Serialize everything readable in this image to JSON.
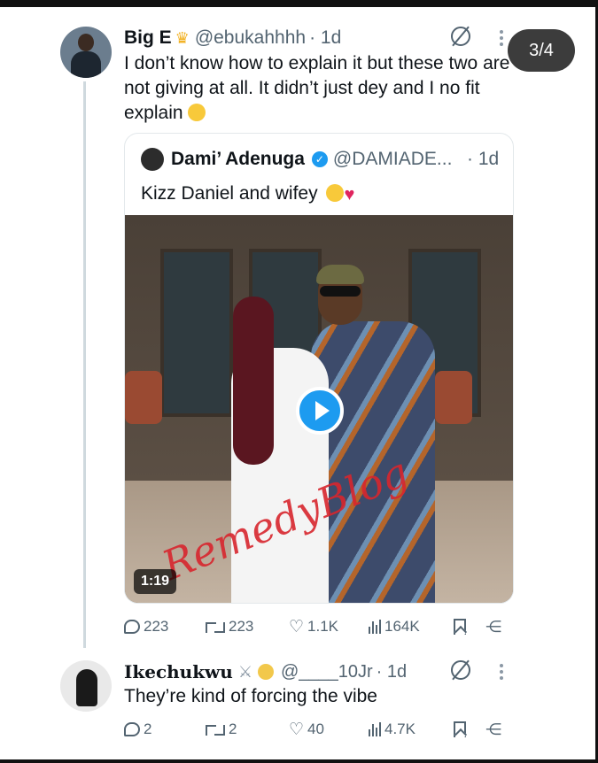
{
  "pager": "3/4",
  "main_tweet": {
    "name": "Big E",
    "handle": "@ebukahhhh",
    "time": "· 1d",
    "text": "I don’t know how to explain it but these two are not giving at all. It didn’t just dey and I no fit explain",
    "actions": {
      "replies": "223",
      "reposts": "223",
      "likes": "1.1K",
      "views": "164K"
    }
  },
  "quoted_tweet": {
    "name": "Dami’ Adenuga",
    "handle": "@DAMIADE...",
    "time": "· 1d",
    "text": "Kizz Daniel and wifey",
    "video": {
      "duration": "1:19",
      "watermark": "RemedyBlog"
    }
  },
  "reply_tweet": {
    "name": "Ikechukwu",
    "handle": "@____10Jr",
    "time": "· 1d",
    "text": "They’re kind of forcing the vibe",
    "actions": {
      "replies": "2",
      "reposts": "2",
      "likes": "40",
      "views": "4.7K"
    }
  },
  "colors": {
    "accent": "#1d9bf0",
    "muted": "#536471",
    "text": "#0f1419"
  },
  "icons": [
    "grok-icon",
    "more-icon",
    "reply-icon",
    "repost-icon",
    "like-icon",
    "views-icon",
    "bookmark-icon",
    "share-icon",
    "play-icon",
    "verified-icon"
  ]
}
